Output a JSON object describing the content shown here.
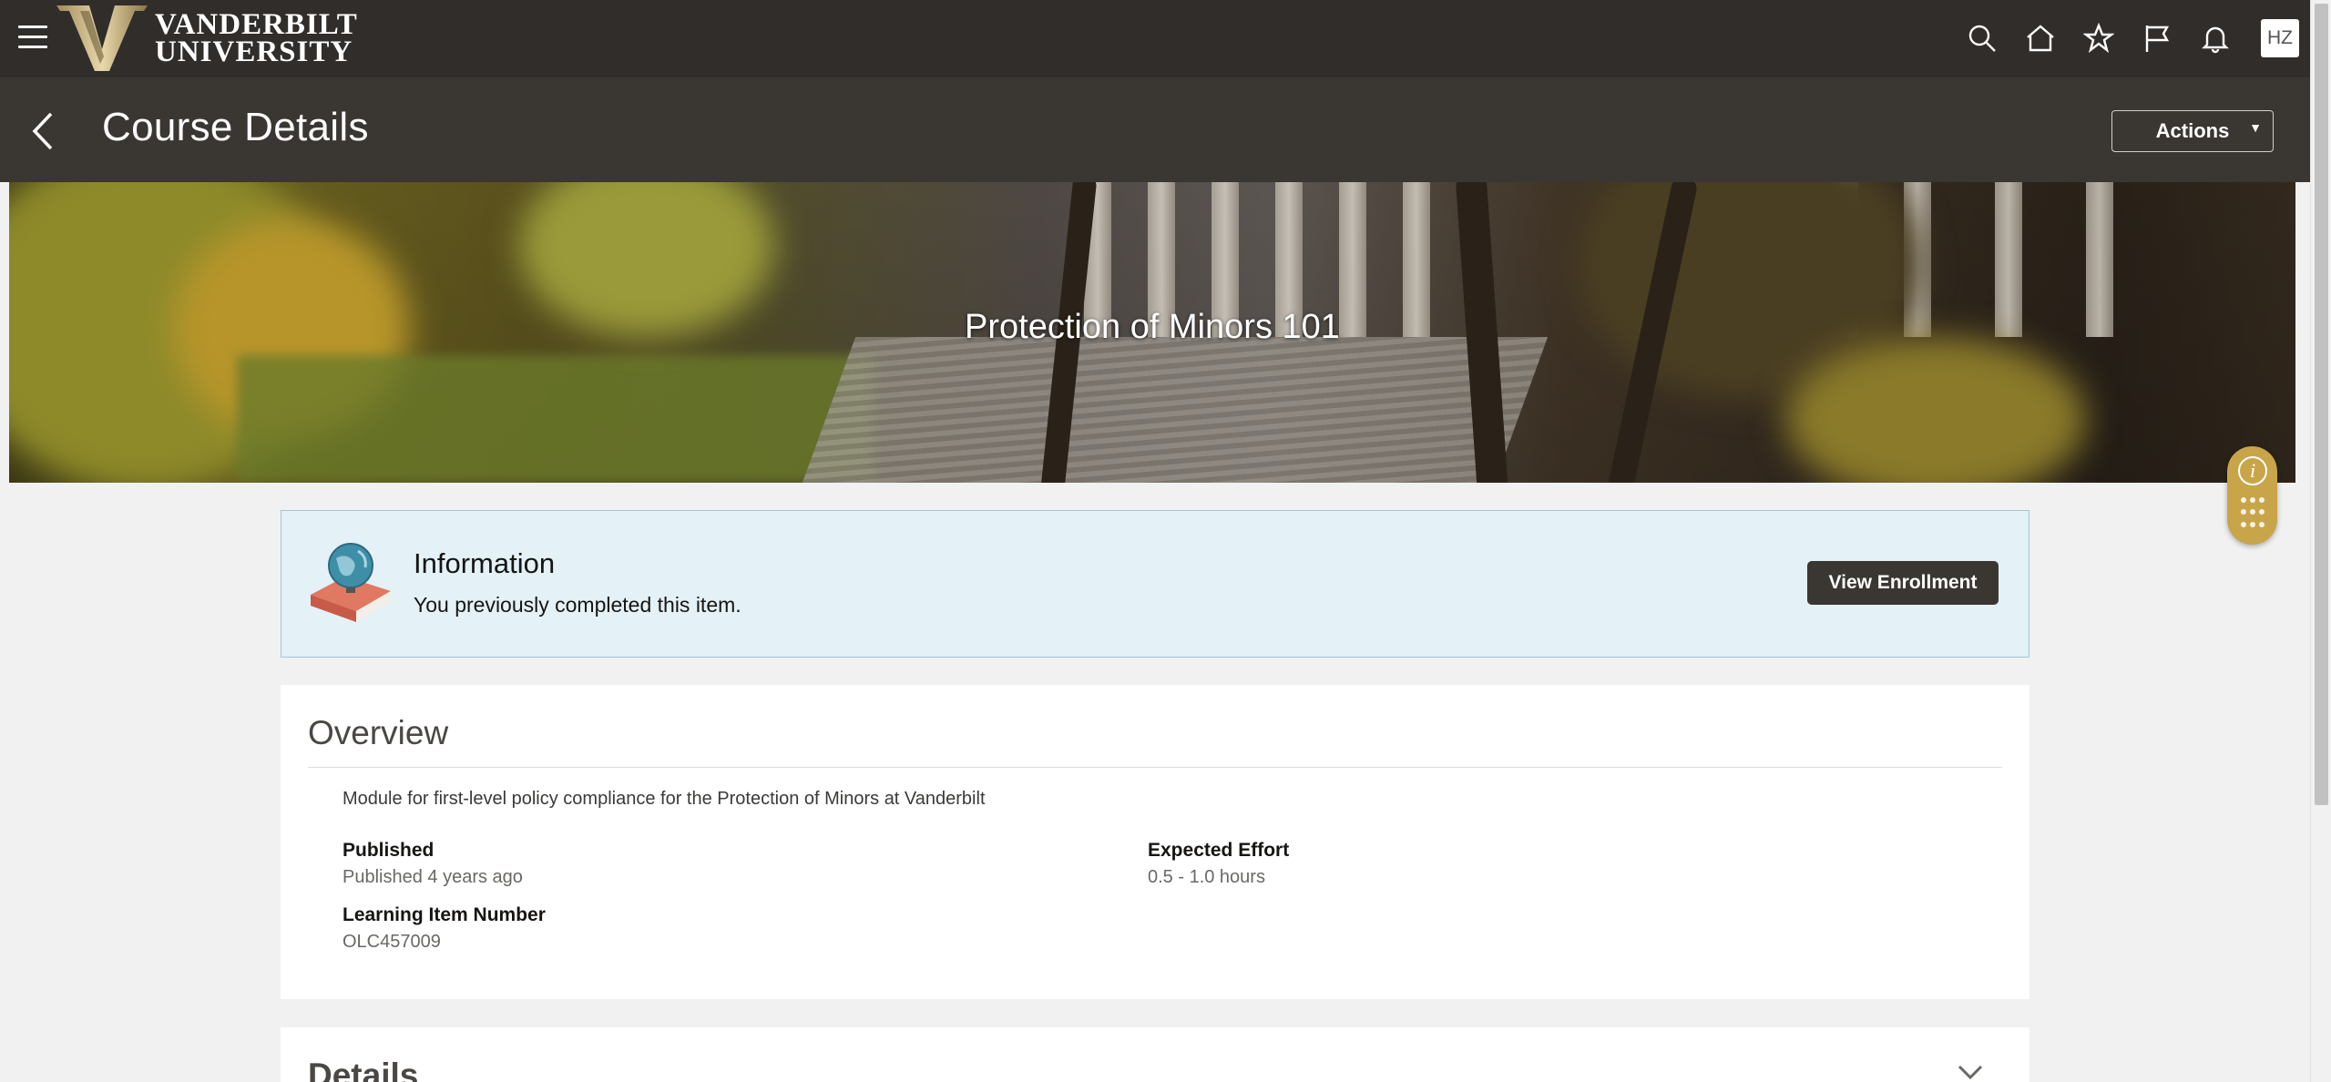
{
  "header": {
    "logo_text_line1": "VANDERBILT",
    "logo_text_line2": "UNIVERSITY",
    "avatar_initials": "HZ",
    "icons": [
      "hamburger-icon",
      "search-icon",
      "home-icon",
      "star-icon",
      "flag-icon",
      "bell-icon"
    ]
  },
  "page": {
    "title": "Course Details",
    "actions_label": "Actions"
  },
  "hero": {
    "title": "Protection of Minors 101"
  },
  "info": {
    "title": "Information",
    "text": "You previously completed this item.",
    "button_label": "View Enrollment"
  },
  "overview": {
    "title": "Overview",
    "description": "Module for first-level policy compliance for the Protection of Minors at Vanderbilt",
    "published_label": "Published",
    "published_value": "Published 4 years ago",
    "effort_label": "Expected Effort",
    "effort_value": "0.5 - 1.0 hours",
    "item_number_label": "Learning Item Number",
    "item_number_value": "OLC457009"
  },
  "details": {
    "title": "Details"
  },
  "colors": {
    "topbar": "#312d2a",
    "pagebar": "#3a3632",
    "info_bg": "#e4f1f7",
    "widget": "#c9a54a"
  }
}
